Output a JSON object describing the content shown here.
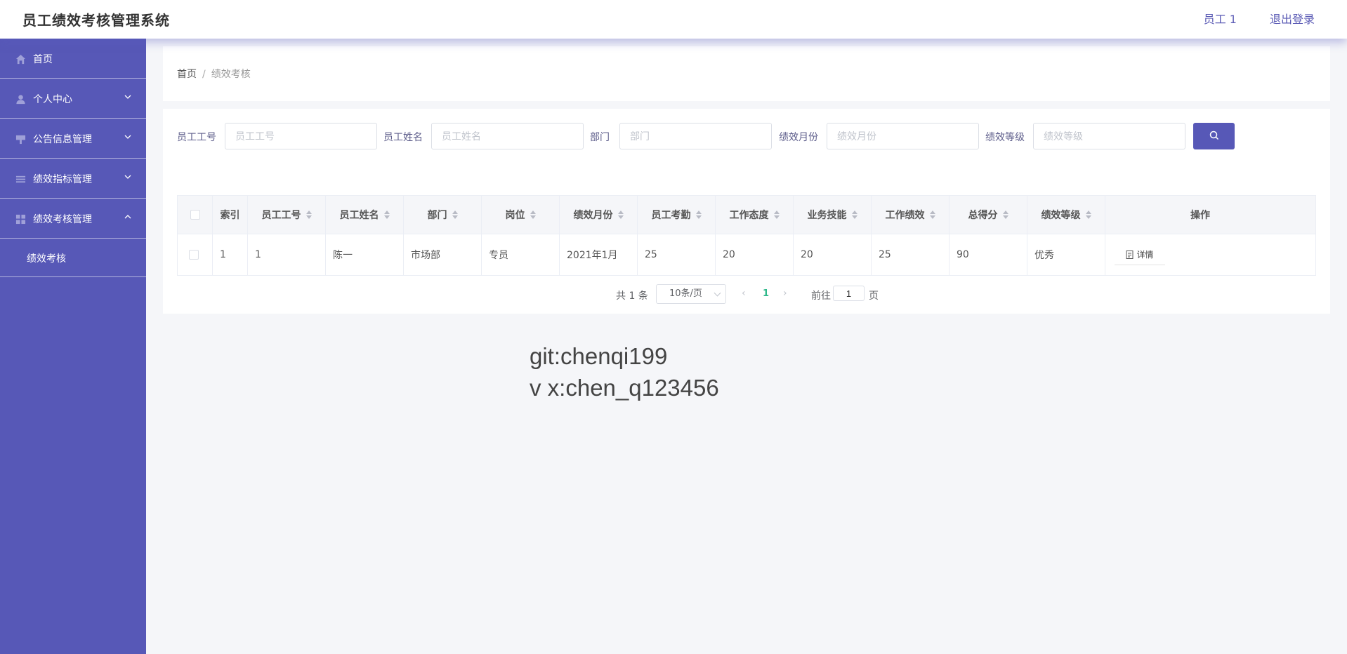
{
  "app": {
    "title": "员工绩效考核管理系统"
  },
  "topbar": {
    "user": "员工 1",
    "logout": "退出登录"
  },
  "sidebar": {
    "items": [
      {
        "label": "首页",
        "icon": "home-icon"
      },
      {
        "label": "个人中心",
        "icon": "user-icon",
        "expanded": false
      },
      {
        "label": "公告信息管理",
        "icon": "notice-icon",
        "expanded": false
      },
      {
        "label": "绩效指标管理",
        "icon": "list-icon",
        "expanded": false
      },
      {
        "label": "绩效考核管理",
        "icon": "grid-icon",
        "expanded": true
      }
    ],
    "subitems": [
      {
        "label": "绩效考核"
      }
    ]
  },
  "breadcrumb": {
    "home": "首页",
    "separator": "/",
    "current": "绩效考核"
  },
  "search": {
    "fields": [
      {
        "label": "员工工号",
        "placeholder": "员工工号"
      },
      {
        "label": "员工姓名",
        "placeholder": "员工姓名"
      },
      {
        "label": "部门",
        "placeholder": "部门"
      },
      {
        "label": "绩效月份",
        "placeholder": "绩效月份"
      },
      {
        "label": "绩效等级",
        "placeholder": "绩效等级"
      }
    ]
  },
  "table": {
    "columns": [
      "索引",
      "员工工号",
      "员工姓名",
      "部门",
      "岗位",
      "绩效月份",
      "员工考勤",
      "工作态度",
      "业务技能",
      "工作绩效",
      "总得分",
      "绩效等级",
      "操作"
    ],
    "rows": [
      {
        "cells": [
          "1",
          "1",
          "陈一",
          "市场部",
          "专员",
          "2021年1月",
          "25",
          "20",
          "20",
          "25",
          "90",
          "优秀"
        ],
        "action": "详情"
      }
    ]
  },
  "pagination": {
    "total": "共 1 条",
    "page_size": "10条/页",
    "current": "1",
    "goto_label": "前往",
    "goto_value": "1",
    "page_suffix": "页"
  },
  "watermark": {
    "line1": "git:chenqi199",
    "line2": "v x:chen_q123456"
  },
  "colors": {
    "primary": "#5758b7",
    "active_page": "#2eb88a"
  }
}
